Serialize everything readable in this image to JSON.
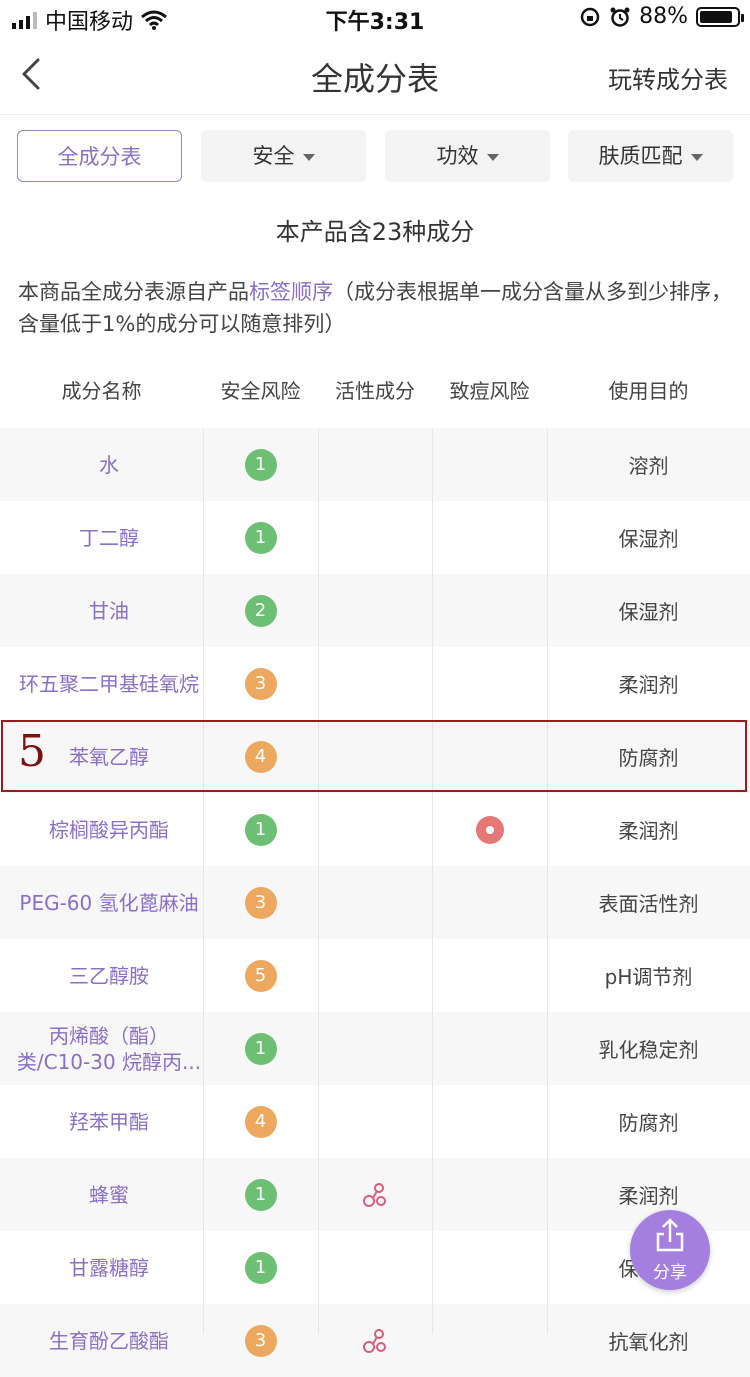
{
  "status_bar": {
    "carrier": "中国移动",
    "time": "下午3:31",
    "battery": "88%",
    "battery_level": 0.88
  },
  "nav": {
    "title": "全成分表",
    "right_link": "玩转成分表"
  },
  "filters": [
    {
      "label": "全成分表"
    },
    {
      "label": "安全"
    },
    {
      "label": "功效"
    },
    {
      "label": "肤质匹配"
    }
  ],
  "summary": "本产品含23种成分",
  "note": {
    "prefix": "本商品全成分表源自产品",
    "link": "标签顺序",
    "suffix": "（成分表根据单一成分含量从多到少排序，含量低于1%的成分可以随意排列）"
  },
  "table": {
    "headers": [
      "成分名称",
      "安全风险",
      "活性成分",
      "致痘风险",
      "使用目的"
    ],
    "rows": [
      {
        "name": "水",
        "safety": "1",
        "active": false,
        "acne": false,
        "purpose": "溶剂"
      },
      {
        "name": "丁二醇",
        "safety": "1",
        "active": false,
        "acne": false,
        "purpose": "保湿剂"
      },
      {
        "name": "甘油",
        "safety": "2",
        "active": false,
        "acne": false,
        "purpose": "保湿剂"
      },
      {
        "name": "环五聚二甲基硅氧烷",
        "safety": "3",
        "active": false,
        "acne": false,
        "purpose": "柔润剂"
      },
      {
        "name": "苯氧乙醇",
        "safety": "4",
        "active": false,
        "acne": false,
        "purpose": "防腐剂"
      },
      {
        "name": "棕榈酸异丙酯",
        "safety": "1",
        "active": false,
        "acne": true,
        "purpose": "柔润剂"
      },
      {
        "name": "PEG-60 氢化蓖麻油",
        "safety": "3",
        "active": false,
        "acne": false,
        "purpose": "表面活性剂"
      },
      {
        "name": "三乙醇胺",
        "safety": "5",
        "active": false,
        "acne": false,
        "purpose": "pH调节剂"
      },
      {
        "name": "丙烯酸（酯）类/C10-30 烷醇丙...",
        "safety": "1",
        "active": false,
        "acne": false,
        "purpose": "乳化稳定剂"
      },
      {
        "name": "羟苯甲酯",
        "safety": "4",
        "active": false,
        "acne": false,
        "purpose": "防腐剂"
      },
      {
        "name": "蜂蜜",
        "safety": "1",
        "active": true,
        "acne": false,
        "purpose": "柔润剂"
      },
      {
        "name": "甘露糖醇",
        "safety": "1",
        "active": false,
        "acne": false,
        "purpose": "保湿剂"
      },
      {
        "name": "生育酚乙酸酯",
        "safety": "3",
        "active": true,
        "acne": false,
        "purpose": "抗氧化剂"
      }
    ]
  },
  "highlight_label": "5",
  "colors": {
    "accent": "#8a6fc4",
    "score_green": "#6cbf73",
    "score_orange": "#eba85e",
    "acne_red": "#e57777",
    "share_bg": "#a57fe0",
    "highlight_border": "#9a1c1c"
  },
  "share": {
    "label": "分享",
    "icon": "share-icon"
  }
}
